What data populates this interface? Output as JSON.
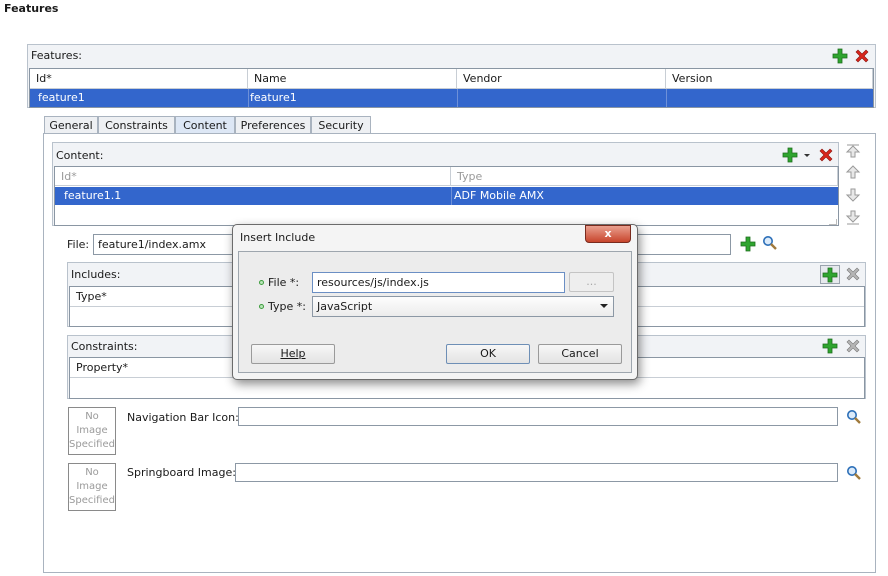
{
  "page": {
    "heading": "Features"
  },
  "features_panel": {
    "title": "Features:",
    "columns": [
      "Id*",
      "Name",
      "Vendor",
      "Version"
    ],
    "row": {
      "id": "feature1",
      "name": "feature1",
      "vendor": "",
      "version": ""
    }
  },
  "tabs": [
    "General",
    "Constraints",
    "Content",
    "Preferences",
    "Security"
  ],
  "active_tab": "Content",
  "content_panel": {
    "title": "Content:",
    "columns": [
      "Id*",
      "Type"
    ],
    "row": {
      "id": "feature1.1",
      "type": "ADF Mobile AMX"
    }
  },
  "file_field": {
    "label": "File:",
    "value": "feature1/index.amx"
  },
  "includes_panel": {
    "title": "Includes:",
    "column": "Type*"
  },
  "constraints_panel": {
    "title": "Constraints:",
    "column": "Property*"
  },
  "navigation_bar_icon": {
    "label": "Navigation Bar Icon:",
    "placeholder_text": "No Image Specified"
  },
  "springboard_image": {
    "label": "Springboard Image:",
    "placeholder_text": "No Image Specified"
  },
  "dialog": {
    "title": "Insert Include",
    "close_label": "x",
    "file_label": "File *:",
    "file_value": "resources/js/index.js",
    "browse_label": "...",
    "type_label": "Type *:",
    "type_value": "JavaScript",
    "help_label": "Help",
    "ok_label": "OK",
    "cancel_label": "Cancel"
  },
  "colors": {
    "selection": "#3366cc",
    "add_icon": "#2fa52f",
    "delete_icon": "#d9261c"
  },
  "icons": [
    "add-icon",
    "delete-icon",
    "search-icon",
    "move-up-icon",
    "move-down-icon",
    "dropdown-icon"
  ]
}
